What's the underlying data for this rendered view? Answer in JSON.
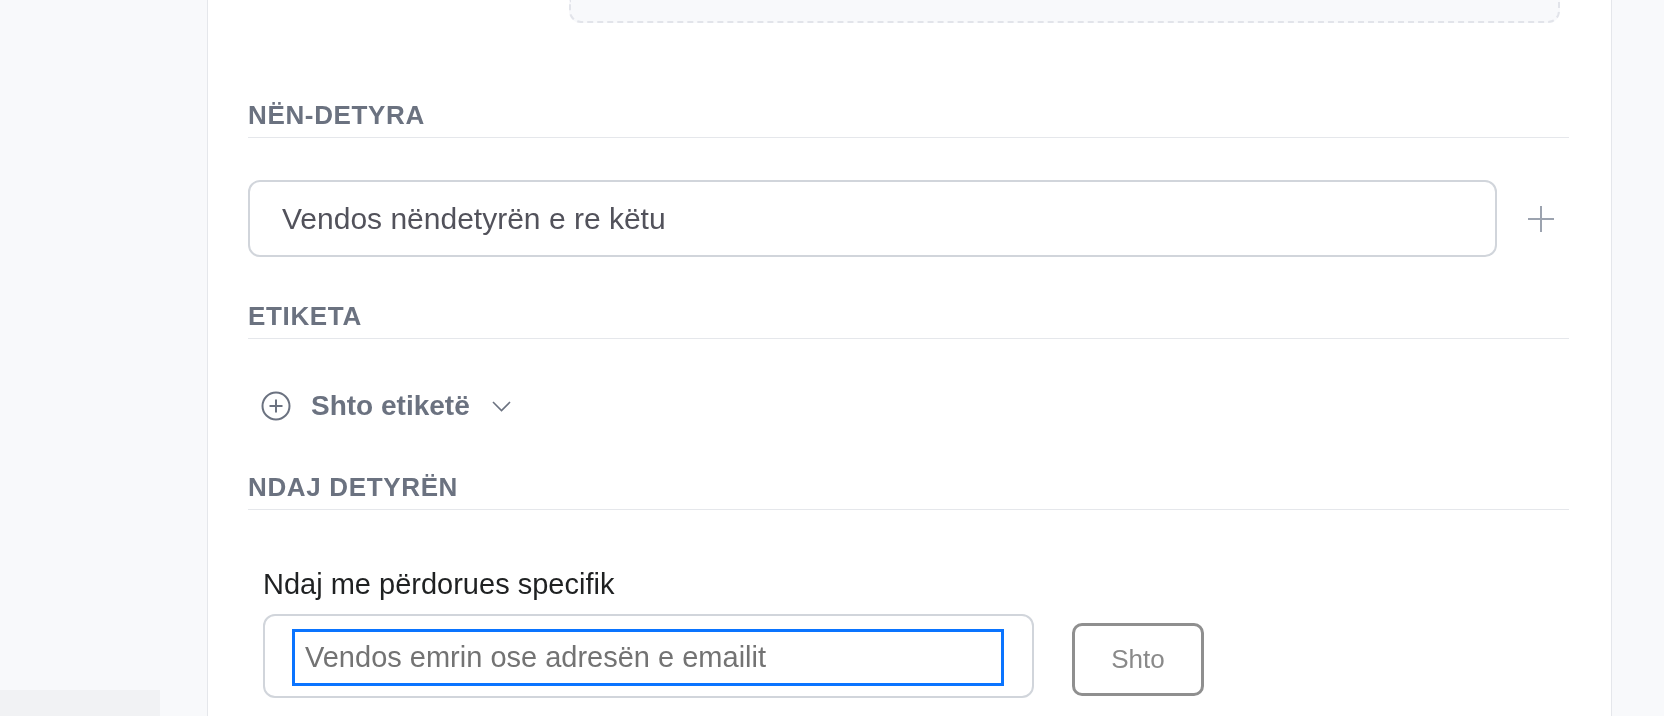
{
  "sections": [
    {
      "kind": "subtasks",
      "heading": "NËN-DETYRA",
      "input": {
        "placeholder": "Vendos nëndetyrën e re këtu"
      }
    },
    {
      "kind": "tags",
      "heading": "ETIKETA",
      "add_button": {
        "label": "Shto etiketë"
      }
    },
    {
      "kind": "share",
      "heading": "NDAJ DETYRËN",
      "label": "Ndaj me përdorues specifik",
      "input": {
        "placeholder": "Vendos emrin ose adresën e emailit",
        "focused": true
      },
      "button": {
        "label": "Shto",
        "disabled": true
      }
    }
  ]
}
